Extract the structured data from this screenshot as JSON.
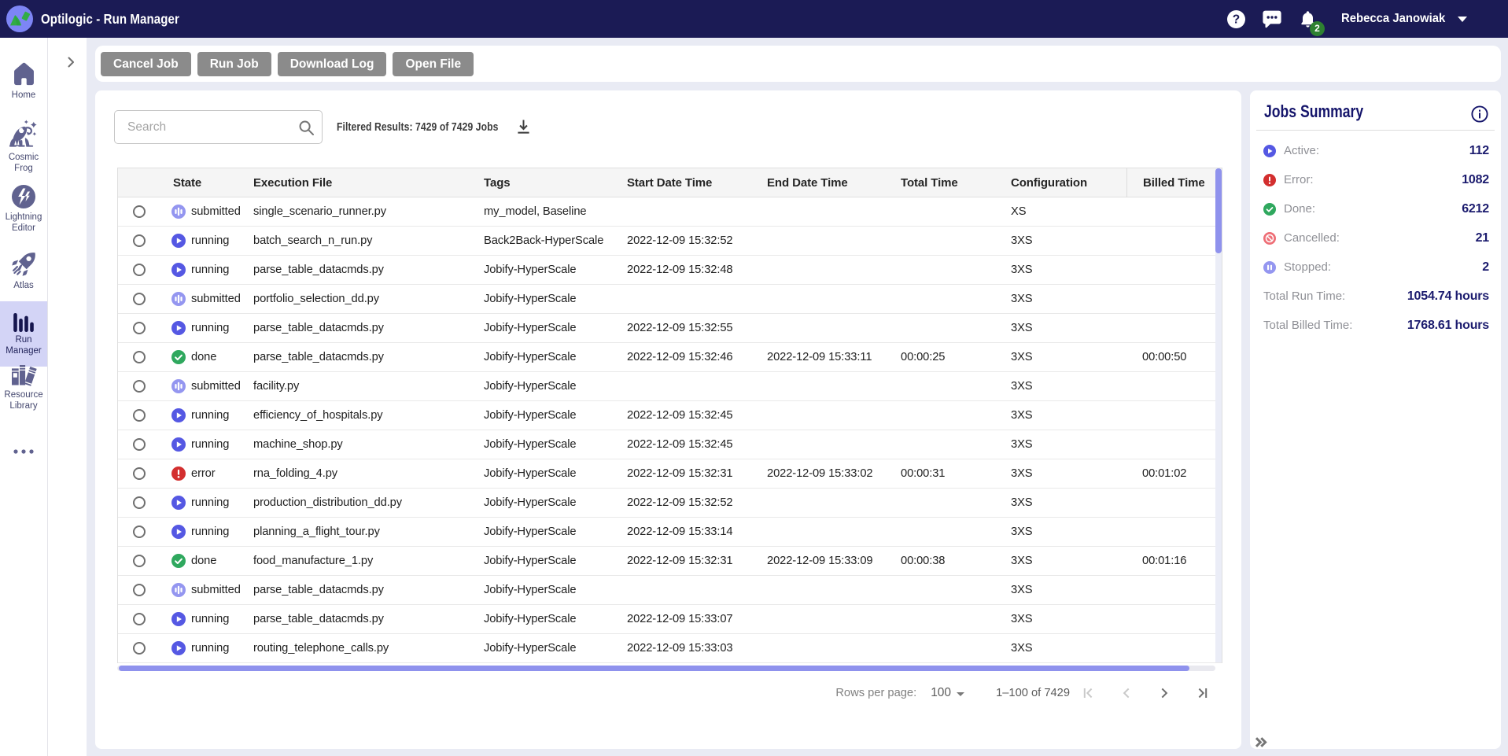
{
  "topbar": {
    "title": "Optilogic - Run Manager",
    "user": "Rebecca Janowiak",
    "notification_count": "2"
  },
  "sidebar": {
    "items": [
      {
        "label": "Home"
      },
      {
        "label": "Cosmic Frog"
      },
      {
        "label": "Lightning Editor"
      },
      {
        "label": "Atlas"
      },
      {
        "label": "Run Manager"
      },
      {
        "label": "Resource Library"
      }
    ]
  },
  "toolbar": {
    "buttons": [
      "Cancel Job",
      "Run Job",
      "Download Log",
      "Open File"
    ]
  },
  "search": {
    "placeholder": "Search"
  },
  "results": {
    "text": "Filtered Results: 7429 of 7429 Jobs"
  },
  "table": {
    "headers": [
      "State",
      "Execution File",
      "Tags",
      "Start Date Time",
      "End Date Time",
      "Total Time",
      "Configuration",
      "Billed Time"
    ],
    "rows": [
      {
        "state": "submitted",
        "file": "single_scenario_runner.py",
        "tags": "my_model, Baseline",
        "start": "",
        "end": "",
        "total": "",
        "config": "XS",
        "billed": ""
      },
      {
        "state": "running",
        "file": "batch_search_n_run.py",
        "tags": "Back2Back-HyperScale",
        "start": "2022-12-09 15:32:52",
        "end": "",
        "total": "",
        "config": "3XS",
        "billed": ""
      },
      {
        "state": "running",
        "file": "parse_table_datacmds.py",
        "tags": "Jobify-HyperScale",
        "start": "2022-12-09 15:32:48",
        "end": "",
        "total": "",
        "config": "3XS",
        "billed": ""
      },
      {
        "state": "submitted",
        "file": "portfolio_selection_dd.py",
        "tags": "Jobify-HyperScale",
        "start": "",
        "end": "",
        "total": "",
        "config": "3XS",
        "billed": ""
      },
      {
        "state": "running",
        "file": "parse_table_datacmds.py",
        "tags": "Jobify-HyperScale",
        "start": "2022-12-09 15:32:55",
        "end": "",
        "total": "",
        "config": "3XS",
        "billed": ""
      },
      {
        "state": "done",
        "file": "parse_table_datacmds.py",
        "tags": "Jobify-HyperScale",
        "start": "2022-12-09 15:32:46",
        "end": "2022-12-09 15:33:11",
        "total": "00:00:25",
        "config": "3XS",
        "billed": "00:00:50"
      },
      {
        "state": "submitted",
        "file": "facility.py",
        "tags": "Jobify-HyperScale",
        "start": "",
        "end": "",
        "total": "",
        "config": "3XS",
        "billed": ""
      },
      {
        "state": "running",
        "file": "efficiency_of_hospitals.py",
        "tags": "Jobify-HyperScale",
        "start": "2022-12-09 15:32:45",
        "end": "",
        "total": "",
        "config": "3XS",
        "billed": ""
      },
      {
        "state": "running",
        "file": "machine_shop.py",
        "tags": "Jobify-HyperScale",
        "start": "2022-12-09 15:32:45",
        "end": "",
        "total": "",
        "config": "3XS",
        "billed": ""
      },
      {
        "state": "error",
        "file": "rna_folding_4.py",
        "tags": "Jobify-HyperScale",
        "start": "2022-12-09 15:32:31",
        "end": "2022-12-09 15:33:02",
        "total": "00:00:31",
        "config": "3XS",
        "billed": "00:01:02"
      },
      {
        "state": "running",
        "file": "production_distribution_dd.py",
        "tags": "Jobify-HyperScale",
        "start": "2022-12-09 15:32:52",
        "end": "",
        "total": "",
        "config": "3XS",
        "billed": ""
      },
      {
        "state": "running",
        "file": "planning_a_flight_tour.py",
        "tags": "Jobify-HyperScale",
        "start": "2022-12-09 15:33:14",
        "end": "",
        "total": "",
        "config": "3XS",
        "billed": ""
      },
      {
        "state": "done",
        "file": "food_manufacture_1.py",
        "tags": "Jobify-HyperScale",
        "start": "2022-12-09 15:32:31",
        "end": "2022-12-09 15:33:09",
        "total": "00:00:38",
        "config": "3XS",
        "billed": "00:01:16"
      },
      {
        "state": "submitted",
        "file": "parse_table_datacmds.py",
        "tags": "Jobify-HyperScale",
        "start": "",
        "end": "",
        "total": "",
        "config": "3XS",
        "billed": ""
      },
      {
        "state": "running",
        "file": "parse_table_datacmds.py",
        "tags": "Jobify-HyperScale",
        "start": "2022-12-09 15:33:07",
        "end": "",
        "total": "",
        "config": "3XS",
        "billed": ""
      },
      {
        "state": "running",
        "file": "routing_telephone_calls.py",
        "tags": "Jobify-HyperScale",
        "start": "2022-12-09 15:33:03",
        "end": "",
        "total": "",
        "config": "3XS",
        "billed": ""
      }
    ]
  },
  "pagination": {
    "rows_per_page_label": "Rows per page:",
    "rows_per_page": "100",
    "range": "1–100 of 7429"
  },
  "summary": {
    "title": "Jobs Summary",
    "stats": [
      {
        "label": "Active:",
        "value": "112",
        "state": "running"
      },
      {
        "label": "Error:",
        "value": "1082",
        "state": "error"
      },
      {
        "label": "Done:",
        "value": "6212",
        "state": "done"
      },
      {
        "label": "Cancelled:",
        "value": "21",
        "state": "cancelled"
      },
      {
        "label": "Stopped:",
        "value": "2",
        "state": "stopped"
      }
    ],
    "totals": [
      {
        "label": "Total Run Time:",
        "value": "1054.74 hours"
      },
      {
        "label": "Total Billed Time:",
        "value": "1768.61 hours"
      }
    ]
  },
  "colors": {
    "topbar": "#1b1b55",
    "accent": "#8f92ed",
    "running": "#5558e3",
    "submitted": "#9496f0",
    "done": "#2fa85e",
    "error": "#d32f2f",
    "cancelled": "#ee6e76",
    "navy_text": "#1b1b6e"
  }
}
